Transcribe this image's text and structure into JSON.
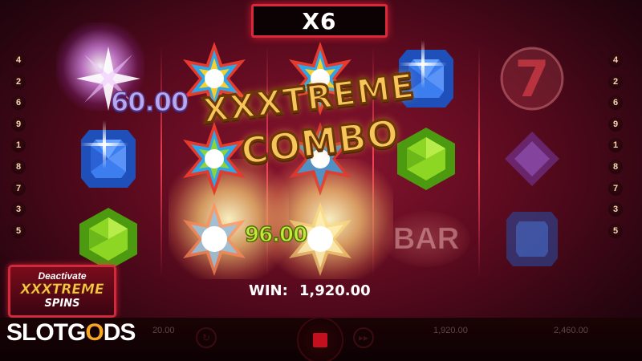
{
  "multiplier": "X6",
  "paylines_left": [
    "4",
    "2",
    "6",
    "9",
    "1",
    "8",
    "7",
    "3",
    "5"
  ],
  "paylines_right": [
    "4",
    "2",
    "6",
    "9",
    "1",
    "8",
    "7",
    "3",
    "5"
  ],
  "floating_wins": {
    "value_1": "60.00",
    "value_2": "96.00"
  },
  "combo_banner": {
    "line1": "XXXTREME",
    "line2": "COMBO"
  },
  "bar_symbol": "BAR",
  "seven_symbol": "7",
  "win": {
    "label": "WIN:",
    "amount": "1,920.00"
  },
  "feature_button": {
    "line1": "Deactivate",
    "line2": "XXXTREME",
    "line3": "SPINS"
  },
  "bottom_stats": {
    "bet_value": "20.00",
    "win_value": "1,920.00",
    "balance_value": "2,460.00"
  },
  "brand": {
    "part1": "SLOTG",
    "part2": "O",
    "part3": "DS"
  },
  "colors": {
    "accent_red": "#d8283a",
    "gold": "#f7c55a",
    "blue_gem": "#2d6be0",
    "green_gem": "#7ac81e",
    "purple_gem": "#7a3fb0"
  },
  "icons": [
    "seven-icon",
    "gem-icon",
    "star-gem-icon",
    "stop-icon",
    "fast-forward-icon",
    "autoplay-icon"
  ]
}
